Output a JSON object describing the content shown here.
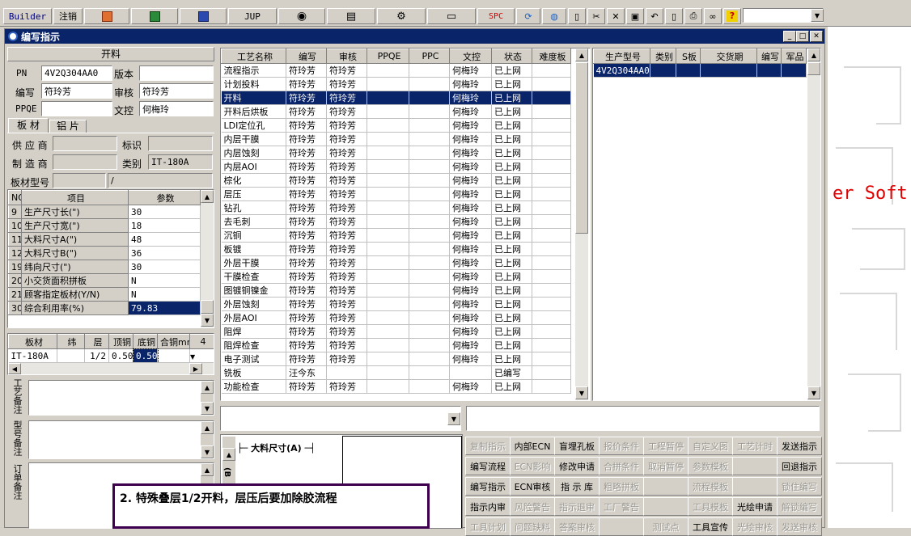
{
  "toolbar": {
    "builder": "Builder",
    "logout": "注销",
    "jup": "JUP",
    "spc": "SPC"
  },
  "window": {
    "title": "编写指示"
  },
  "left": {
    "section_title": "开料",
    "pn_label": "PN",
    "pn_value": "4V2Q304AA0",
    "version_label": "版本",
    "version_value": "",
    "author_label": "编写",
    "author_value": "符玲芳",
    "reviewer_label": "审核",
    "reviewer_value": "符玲芳",
    "ppqe_label": "PPQE",
    "ppqe_value": "",
    "doc_label": "文控",
    "doc_value": "何梅玲",
    "tab_board": "板 材",
    "tab_copper": "铝 片",
    "supplier_label": "供 应 商",
    "supplier_value": "",
    "mark_label": "标识",
    "mark_value": "",
    "maker_label": "制 造 商",
    "maker_value": "",
    "type_label": "类别",
    "type_value": "IT-180A",
    "board_model_label": "板材型号",
    "board_model_value": "",
    "board_model_value2": "/",
    "param_headers": [
      "NO",
      "项目",
      "参数"
    ],
    "params": [
      {
        "no": "9",
        "item": "生产尺寸长(\")",
        "value": "30"
      },
      {
        "no": "10",
        "item": "生产尺寸宽(\")",
        "value": "18"
      },
      {
        "no": "11",
        "item": "大料尺寸A(\")",
        "value": "48"
      },
      {
        "no": "12",
        "item": "大料尺寸B(\")",
        "value": "36"
      },
      {
        "no": "19",
        "item": "纬向尺寸(\")",
        "value": "30"
      },
      {
        "no": "20",
        "item": "小交货面积拼板",
        "value": "N"
      },
      {
        "no": "21",
        "item": "顾客指定板材(Y/N)",
        "value": "N"
      },
      {
        "no": "30",
        "item": "综合利用率(%)",
        "value": "79.83"
      }
    ],
    "mat_headers": [
      "板材",
      "纬",
      "层",
      "顶铜",
      "底铜",
      "合铜mm",
      "4"
    ],
    "mat_row": [
      "IT-180A",
      "",
      "1/2",
      "0.50",
      "0.50",
      ""
    ],
    "note_process": "工艺备注",
    "note_model": "型号备注",
    "note_order": "订单备注"
  },
  "proc": {
    "headers": [
      "工艺名称",
      "编写",
      "审核",
      "PPQE",
      "PPC",
      "文控",
      "状态",
      "难度板"
    ],
    "rows": [
      [
        "流程指示",
        "符玲芳",
        "符玲芳",
        "",
        "",
        "何梅玲",
        "已上网",
        ""
      ],
      [
        "计划投料",
        "符玲芳",
        "符玲芳",
        "",
        "",
        "何梅玲",
        "已上网",
        ""
      ],
      [
        "开料",
        "符玲芳",
        "符玲芳",
        "",
        "",
        "何梅玲",
        "已上网",
        ""
      ],
      [
        "开料后烘板",
        "符玲芳",
        "符玲芳",
        "",
        "",
        "何梅玲",
        "已上网",
        ""
      ],
      [
        "LDI定位孔",
        "符玲芳",
        "符玲芳",
        "",
        "",
        "何梅玲",
        "已上网",
        ""
      ],
      [
        "内层干膜",
        "符玲芳",
        "符玲芳",
        "",
        "",
        "何梅玲",
        "已上网",
        ""
      ],
      [
        "内层蚀刻",
        "符玲芳",
        "符玲芳",
        "",
        "",
        "何梅玲",
        "已上网",
        ""
      ],
      [
        "内层AOI",
        "符玲芳",
        "符玲芳",
        "",
        "",
        "何梅玲",
        "已上网",
        ""
      ],
      [
        "棕化",
        "符玲芳",
        "符玲芳",
        "",
        "",
        "何梅玲",
        "已上网",
        ""
      ],
      [
        "层压",
        "符玲芳",
        "符玲芳",
        "",
        "",
        "何梅玲",
        "已上网",
        ""
      ],
      [
        "钻孔",
        "符玲芳",
        "符玲芳",
        "",
        "",
        "何梅玲",
        "已上网",
        ""
      ],
      [
        "去毛刺",
        "符玲芳",
        "符玲芳",
        "",
        "",
        "何梅玲",
        "已上网",
        ""
      ],
      [
        "沉铜",
        "符玲芳",
        "符玲芳",
        "",
        "",
        "何梅玲",
        "已上网",
        ""
      ],
      [
        "板镀",
        "符玲芳",
        "符玲芳",
        "",
        "",
        "何梅玲",
        "已上网",
        ""
      ],
      [
        "外层干膜",
        "符玲芳",
        "符玲芳",
        "",
        "",
        "何梅玲",
        "已上网",
        ""
      ],
      [
        "干膜检查",
        "符玲芳",
        "符玲芳",
        "",
        "",
        "何梅玲",
        "已上网",
        ""
      ],
      [
        "图镀铜镍金",
        "符玲芳",
        "符玲芳",
        "",
        "",
        "何梅玲",
        "已上网",
        ""
      ],
      [
        "外层蚀刻",
        "符玲芳",
        "符玲芳",
        "",
        "",
        "何梅玲",
        "已上网",
        ""
      ],
      [
        "外层AOI",
        "符玲芳",
        "符玲芳",
        "",
        "",
        "何梅玲",
        "已上网",
        ""
      ],
      [
        "阻焊",
        "符玲芳",
        "符玲芳",
        "",
        "",
        "何梅玲",
        "已上网",
        ""
      ],
      [
        "阻焊检查",
        "符玲芳",
        "符玲芳",
        "",
        "",
        "何梅玲",
        "已上网",
        ""
      ],
      [
        "电子测试",
        "符玲芳",
        "符玲芳",
        "",
        "",
        "何梅玲",
        "已上网",
        ""
      ],
      [
        "铣板",
        "汪今东",
        "",
        "",
        "",
        "",
        "已编写",
        ""
      ],
      [
        "功能检查",
        "符玲芳",
        "符玲芳",
        "",
        "",
        "何梅玲",
        "已上网",
        ""
      ]
    ]
  },
  "prod": {
    "headers": [
      "生产型号",
      "类别",
      "S板",
      "交货期",
      "编写",
      "军品"
    ],
    "rows": [
      [
        "4V2Q304AA0",
        "",
        "",
        "",
        "",
        ""
      ]
    ]
  },
  "diagram": {
    "label_a": "大料尺寸(A)",
    "label_b": "(B"
  },
  "annotation": "2. 特殊叠层1/2开料，层压后要加除胶流程",
  "desk_text": "er Soft",
  "actions": [
    [
      {
        "t": "复制指示",
        "d": true
      },
      {
        "t": "内部ECN",
        "d": false
      },
      {
        "t": "盲埋孔板",
        "d": false
      },
      {
        "t": "报价条件",
        "d": true
      },
      {
        "t": "工程暂停",
        "d": true
      },
      {
        "t": "自定义图",
        "d": true
      },
      {
        "t": "工艺计时",
        "d": true
      },
      {
        "t": "发送指示",
        "d": false
      }
    ],
    [
      {
        "t": "编写流程",
        "d": false
      },
      {
        "t": "ECN影响",
        "d": true
      },
      {
        "t": "修改申请",
        "d": false
      },
      {
        "t": "合拼条件",
        "d": true
      },
      {
        "t": "取消暂停",
        "d": true
      },
      {
        "t": "参数模板",
        "d": true
      },
      {
        "t": "",
        "d": true
      },
      {
        "t": "回退指示",
        "d": false
      }
    ],
    [
      {
        "t": "编写指示",
        "d": false
      },
      {
        "t": "ECN审核",
        "d": false
      },
      {
        "t": "指 示 库",
        "d": false
      },
      {
        "t": "粗略拼板",
        "d": true
      },
      {
        "t": "",
        "d": true
      },
      {
        "t": "流程模板",
        "d": true
      },
      {
        "t": "",
        "d": true
      },
      {
        "t": "锁住编写",
        "d": true
      }
    ],
    [
      {
        "t": "指示内审",
        "d": false
      },
      {
        "t": "风险警告",
        "d": true
      },
      {
        "t": "指示退审",
        "d": true
      },
      {
        "t": "工厂警告",
        "d": true
      },
      {
        "t": "",
        "d": true
      },
      {
        "t": "工具模板",
        "d": true
      },
      {
        "t": "光绘申请",
        "d": false
      },
      {
        "t": "解锁编写",
        "d": true
      }
    ],
    [
      {
        "t": "工具计划",
        "d": true
      },
      {
        "t": "问题缺料",
        "d": true
      },
      {
        "t": "答案审核",
        "d": true
      },
      {
        "t": "",
        "d": true
      },
      {
        "t": "测试点",
        "d": true
      },
      {
        "t": "工具宣传",
        "d": false
      },
      {
        "t": "光绘审核",
        "d": true
      },
      {
        "t": "发送审核",
        "d": true
      }
    ]
  ]
}
